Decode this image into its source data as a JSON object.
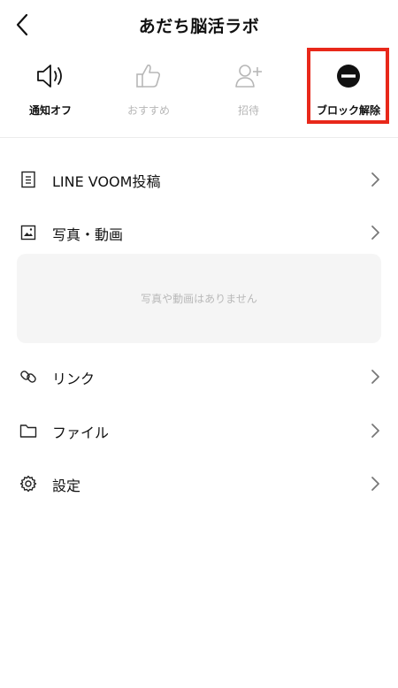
{
  "header": {
    "title": "あだち脳活ラボ",
    "back_icon": "chevron-left-icon"
  },
  "actions": [
    {
      "label": "通知オフ",
      "icon": "speaker-icon",
      "disabled": false
    },
    {
      "label": "おすすめ",
      "icon": "thumbs-up-icon",
      "disabled": true
    },
    {
      "label": "招待",
      "icon": "add-person-icon",
      "disabled": true
    },
    {
      "label": "ブロック解除",
      "icon": "minus-circle-icon",
      "disabled": false,
      "highlighted": true
    }
  ],
  "highlight_color": "#e8281a",
  "menu": [
    {
      "label": "LINE VOOM投稿",
      "icon": "document-icon"
    },
    {
      "label": "写真・動画",
      "icon": "image-icon"
    },
    {
      "label": "リンク",
      "icon": "link-icon"
    },
    {
      "label": "ファイル",
      "icon": "folder-icon"
    },
    {
      "label": "設定",
      "icon": "gear-icon"
    }
  ],
  "media_empty": {
    "text": "写真や動画はありません"
  }
}
